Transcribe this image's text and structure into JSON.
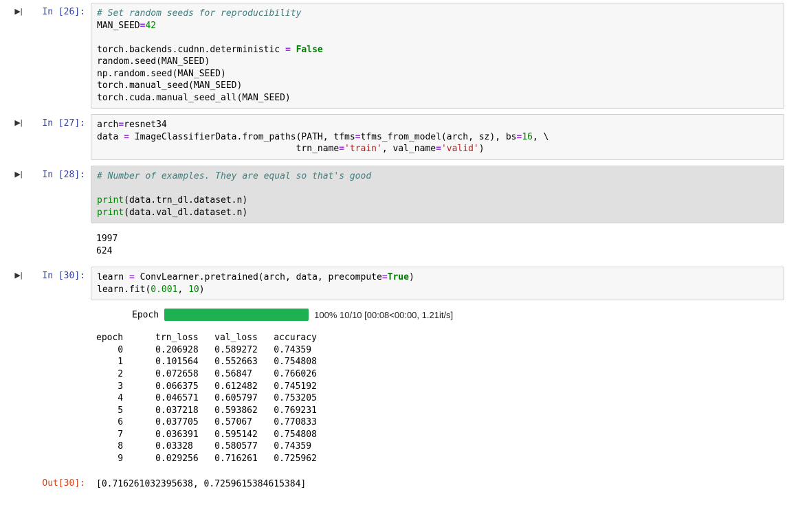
{
  "cells": {
    "c26": {
      "prompt": "In [26]:",
      "code": {
        "l1_comment": "# Set random seeds for reproducibility",
        "l2a": "MAN_SEED",
        "l2b": "=",
        "l2c": "42",
        "l4a": "torch.backends.cudnn.deterministic ",
        "l4b": "=",
        "l4c": " ",
        "l4d": "False",
        "l5": "random.seed(MAN_SEED)",
        "l6": "np.random.seed(MAN_SEED)",
        "l7": "torch.manual_seed(MAN_SEED)",
        "l8": "torch.cuda.manual_seed_all(MAN_SEED)"
      }
    },
    "c27": {
      "prompt": "In [27]:",
      "code": {
        "l1a": "arch",
        "l1b": "=",
        "l1c": "resnet34",
        "l2a": "data ",
        "l2b": "=",
        "l2c": " ImageClassifierData.from_paths(PATH, tfms",
        "l2d": "=",
        "l2e": "tfms_from_model(arch, sz), bs",
        "l2f": "=",
        "l2g": "16",
        "l2h": ", \\",
        "l3a": "                                     trn_name",
        "l3b": "=",
        "l3c": "'train'",
        "l3d": ", val_name",
        "l3e": "=",
        "l3f": "'valid'",
        "l3g": ")"
      }
    },
    "c28": {
      "prompt": "In [28]:",
      "code": {
        "l1_comment": "# Number of examples. They are equal so that's good",
        "l3a": "print",
        "l3b": "(data.trn_dl.dataset.n)",
        "l4a": "print",
        "l4b": "(data.val_dl.dataset.n)"
      },
      "output": "1997\n624"
    },
    "c30": {
      "prompt": "In [30]:",
      "code": {
        "l1a": "learn ",
        "l1b": "=",
        "l1c": " ConvLearner.pretrained(arch, data, precompute",
        "l1d": "=",
        "l1e": "True",
        "l1f": ")",
        "l2a": "learn.fit(",
        "l2b": "0.001",
        "l2c": ", ",
        "l2d": "10",
        "l2e": ")"
      },
      "progress": {
        "label": "Epoch",
        "text": "100% 10/10 [00:08<00:00, 1.21it/s]"
      },
      "train_output": "epoch      trn_loss   val_loss   accuracy\n    0      0.206928   0.589272   0.74359\n    1      0.101564   0.552663   0.754808\n    2      0.072658   0.56847    0.766026\n    3      0.066375   0.612482   0.745192\n    4      0.046571   0.605797   0.753205\n    5      0.037218   0.593862   0.769231\n    6      0.037705   0.57067    0.770833\n    7      0.036391   0.595142   0.754808\n    8      0.03328    0.580577   0.74359\n    9      0.029256   0.716261   0.725962\n",
      "out_prompt": "Out[30]:",
      "out_value": "[0.716261032395638, 0.7259615384615384]"
    }
  },
  "chart_data": {
    "type": "table",
    "title": "Training metrics per epoch",
    "columns": [
      "epoch",
      "trn_loss",
      "val_loss",
      "accuracy"
    ],
    "rows": [
      [
        0,
        0.206928,
        0.589272,
        0.74359
      ],
      [
        1,
        0.101564,
        0.552663,
        0.754808
      ],
      [
        2,
        0.072658,
        0.56847,
        0.766026
      ],
      [
        3,
        0.066375,
        0.612482,
        0.745192
      ],
      [
        4,
        0.046571,
        0.605797,
        0.753205
      ],
      [
        5,
        0.037218,
        0.593862,
        0.769231
      ],
      [
        6,
        0.037705,
        0.57067,
        0.770833
      ],
      [
        7,
        0.036391,
        0.595142,
        0.754808
      ],
      [
        8,
        0.03328,
        0.580577,
        0.74359
      ],
      [
        9,
        0.029256,
        0.716261,
        0.725962
      ]
    ],
    "final_output": [
      0.716261032395638,
      0.7259615384615384
    ]
  }
}
